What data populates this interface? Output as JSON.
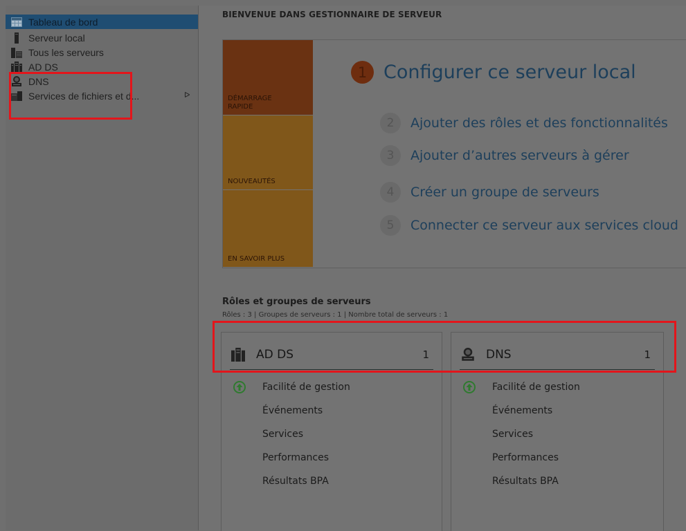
{
  "sidebar": {
    "items": [
      {
        "label": "Tableau de bord",
        "icon": "dashboard-icon",
        "active": true
      },
      {
        "label": "Serveur local",
        "icon": "server-icon"
      },
      {
        "label": "Tous les serveurs",
        "icon": "servers-icon"
      },
      {
        "label": "AD DS",
        "icon": "ad-ds-icon"
      },
      {
        "label": "DNS",
        "icon": "dns-icon"
      },
      {
        "label": "Services de fichiers et d...",
        "icon": "file-services-icon",
        "expand_glyph": "ᐅ"
      }
    ]
  },
  "main": {
    "welcome_title": "BIENVENUE DANS GESTIONNAIRE DE SERVEUR",
    "quickstart": {
      "tiles": [
        "DÉMARRAGE\nRAPIDE",
        "NOUVEAUTÉS",
        "EN SAVOIR PLUS"
      ],
      "steps": [
        {
          "num": "1",
          "text": "Configurer ce serveur local"
        },
        {
          "num": "2",
          "text": "Ajouter des rôles et des fonctionnalités"
        },
        {
          "num": "3",
          "text": "Ajouter d’autres serveurs à gérer"
        },
        {
          "num": "4",
          "text": "Créer un groupe de serveurs"
        },
        {
          "num": "5",
          "text": "Connecter ce serveur aux services cloud"
        }
      ]
    },
    "roles": {
      "title": "Rôles et groupes de serveurs",
      "summary": "Rôles : 3  |  Groupes de serveurs : 1  |  Nombre total de serveurs : 1",
      "tiles": [
        {
          "name": "AD DS",
          "count": "1",
          "icon": "ad-ds-icon",
          "links": [
            "Facilité de gestion",
            "Événements",
            "Services",
            "Performances",
            "Résultats BPA"
          ]
        },
        {
          "name": "DNS",
          "count": "1",
          "icon": "dns-icon",
          "links": [
            "Facilité de gestion",
            "Événements",
            "Services",
            "Performances",
            "Résultats BPA"
          ]
        }
      ]
    }
  },
  "colors": {
    "accent_orange": "#6e2d0f",
    "tile_orange": "#80571a",
    "link_blue": "#1d3f5b",
    "highlight_red": "#e3151b",
    "status_green": "#2f7a2f"
  }
}
